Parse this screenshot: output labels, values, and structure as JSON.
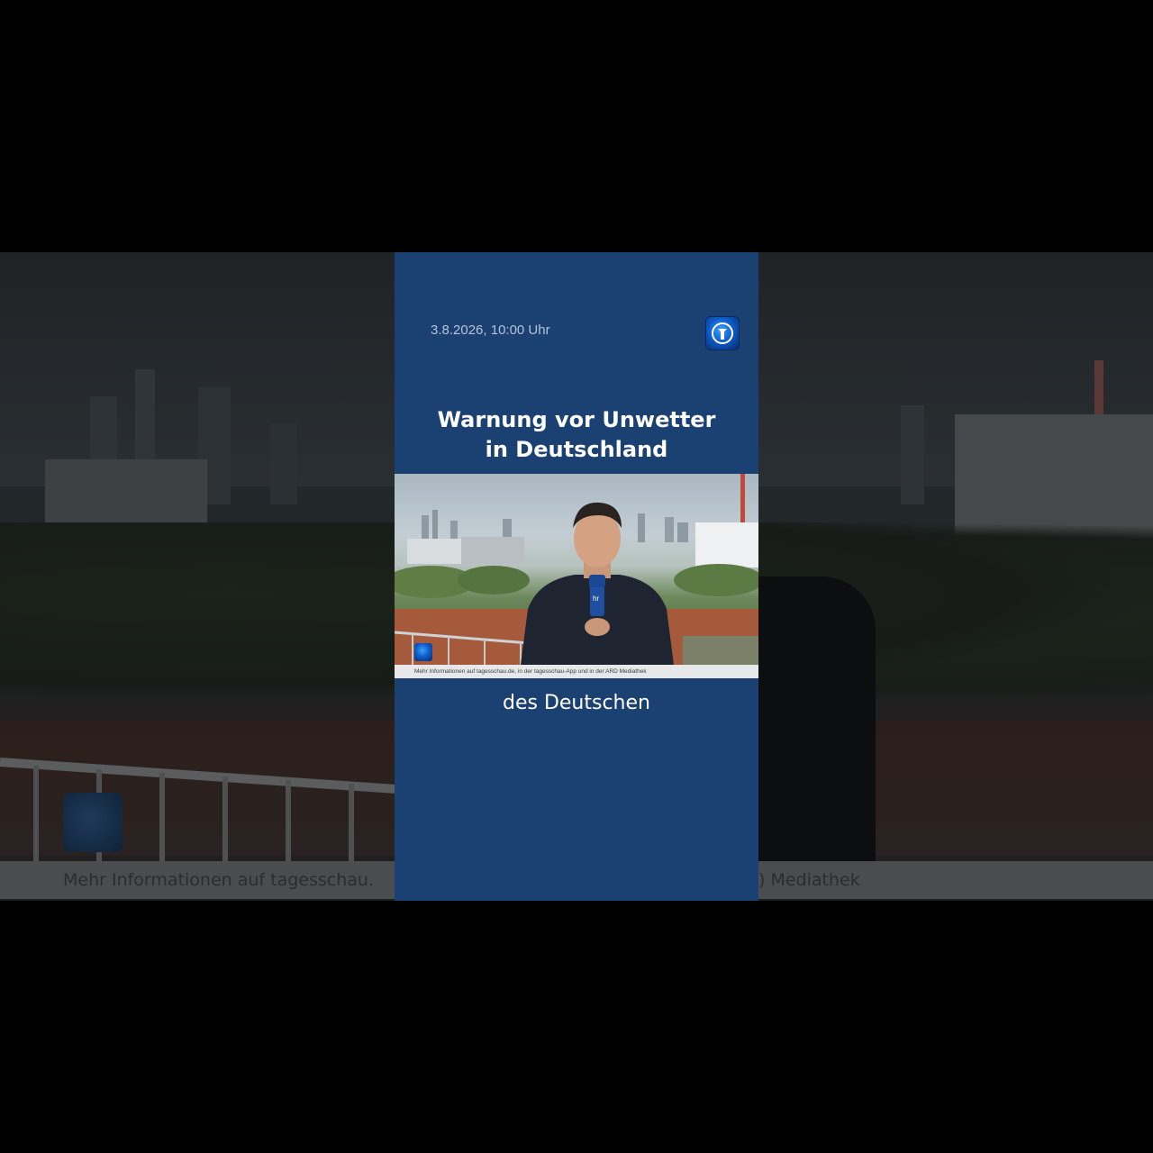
{
  "card": {
    "timestamp": "3.8.2026, 10:00 Uhr",
    "headline_line1": "Warnung vor Unwetter",
    "headline_line2": "in Deutschland",
    "caption": "des Deutschen"
  },
  "video": {
    "ticker": "Mehr Informationen auf tagesschau.de, in der tagesschau-App und in der ARD Mediathek",
    "mic_label": "hr"
  },
  "background": {
    "ticker_left": "Mehr Informationen auf tagesschau.",
    "ticker_right": ") Mediathek"
  },
  "colors": {
    "card_blue": "#1b4172",
    "logo_blue": "#0d5cc9"
  },
  "icons": [
    "tagesschau-logo-icon"
  ]
}
